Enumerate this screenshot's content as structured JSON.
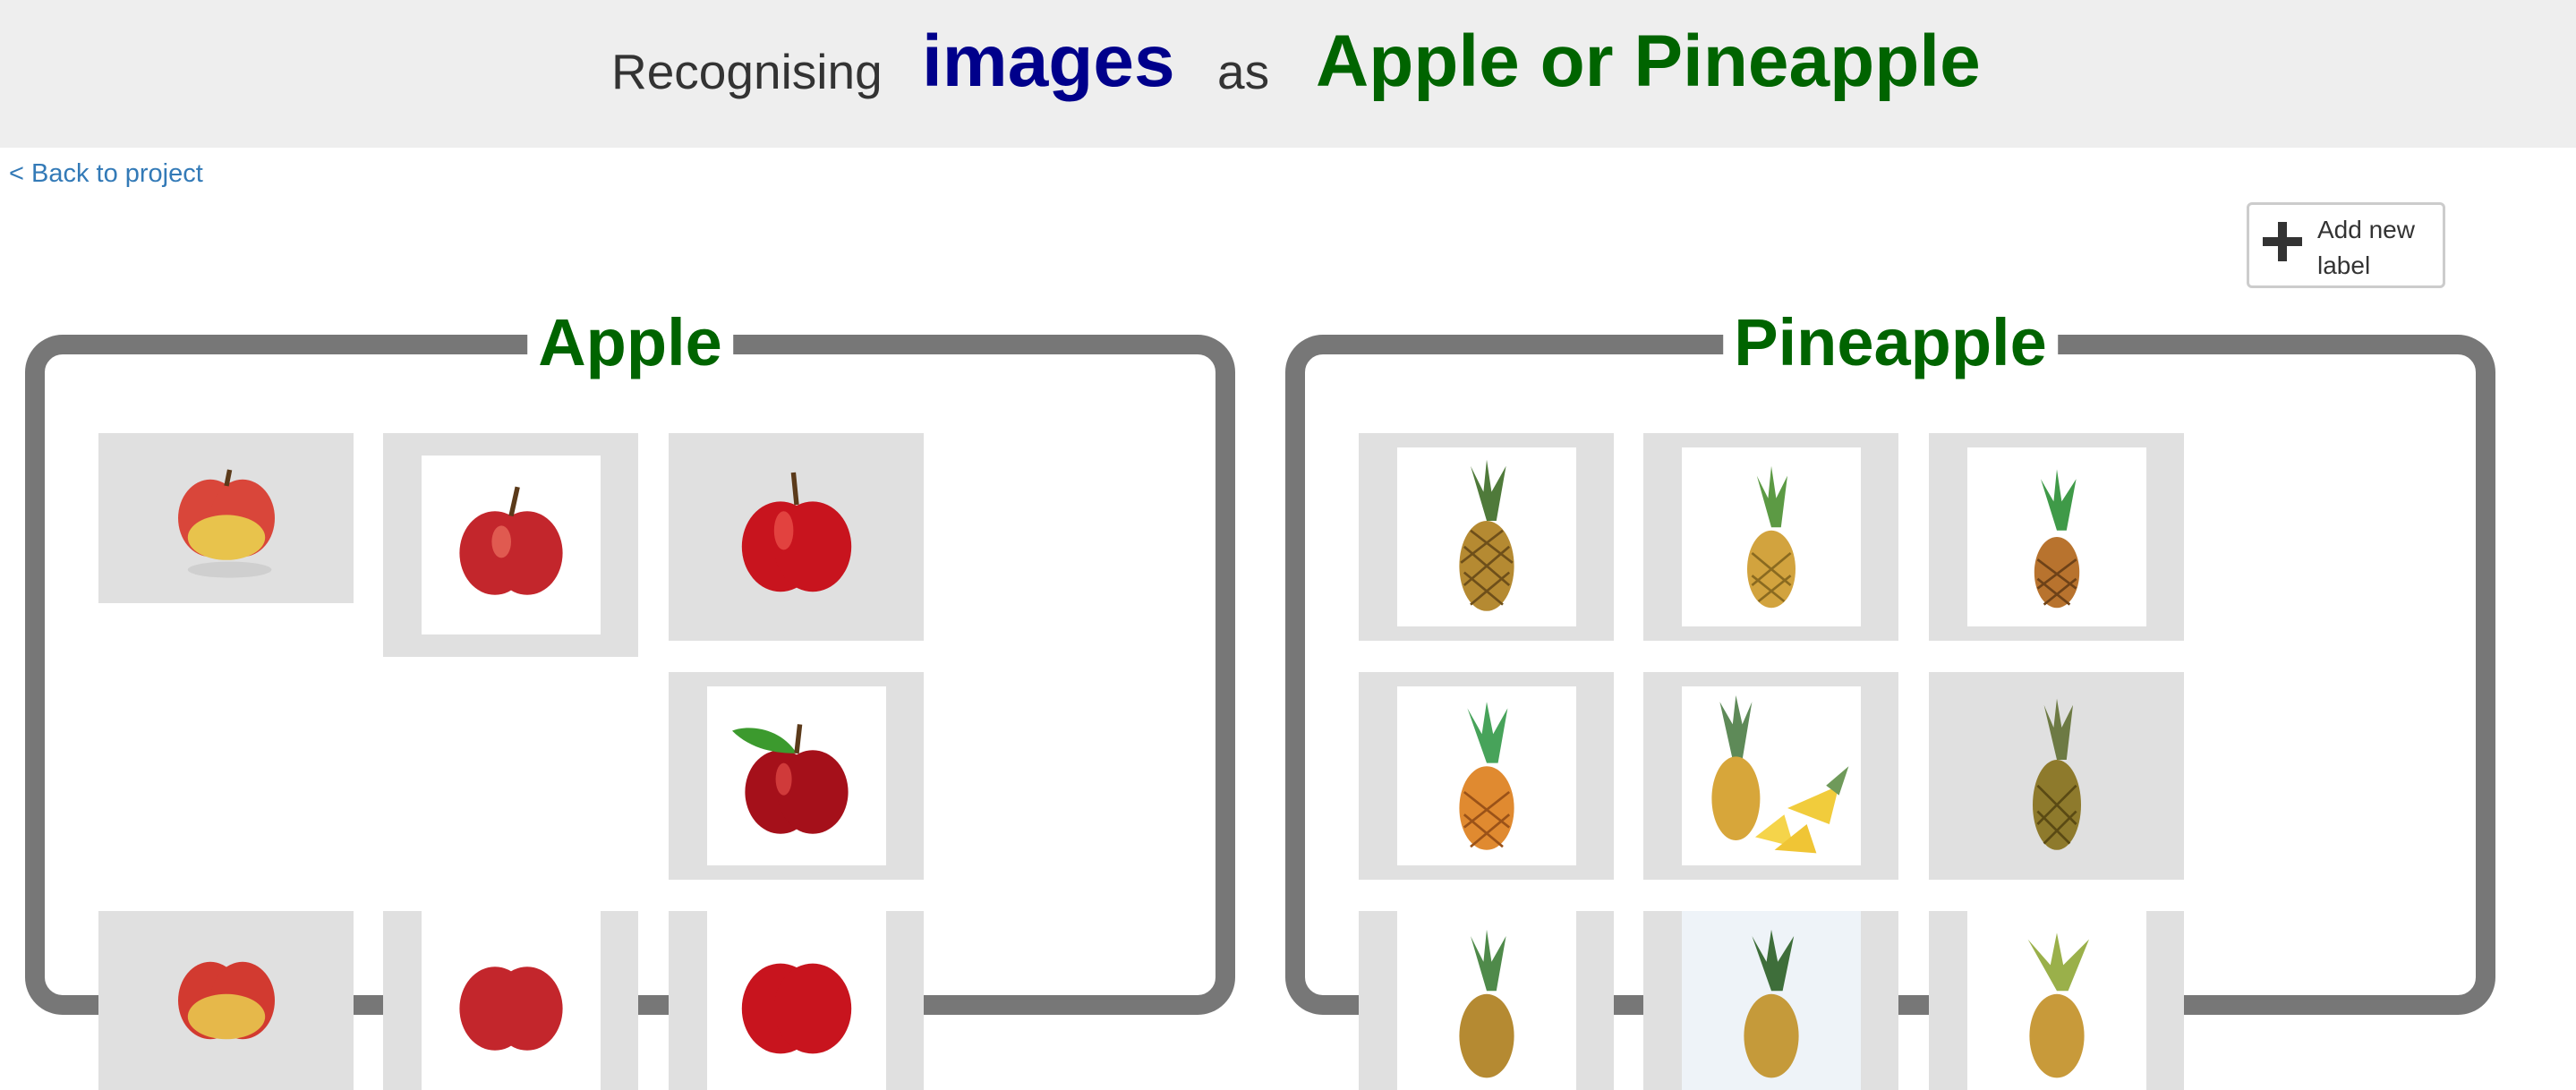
{
  "header": {
    "recognising": "Recognising",
    "type": "images",
    "as": "as",
    "labels": "Apple or Pineapple"
  },
  "back_link": "< Back to project",
  "add_label_button": "Add new label",
  "buckets": [
    {
      "name": "Apple"
    },
    {
      "name": "Pineapple"
    }
  ],
  "icons": {
    "add": "plus-icon",
    "apple_image": "apple-photo",
    "pineapple_image": "pineapple-photo"
  },
  "colors": {
    "header_bg": "#eeeeee",
    "type_color": "#00008b",
    "label_color": "#006400",
    "link": "#337ab7",
    "bucket_border": "#777777",
    "tile_bg": "#e0e0e0"
  }
}
